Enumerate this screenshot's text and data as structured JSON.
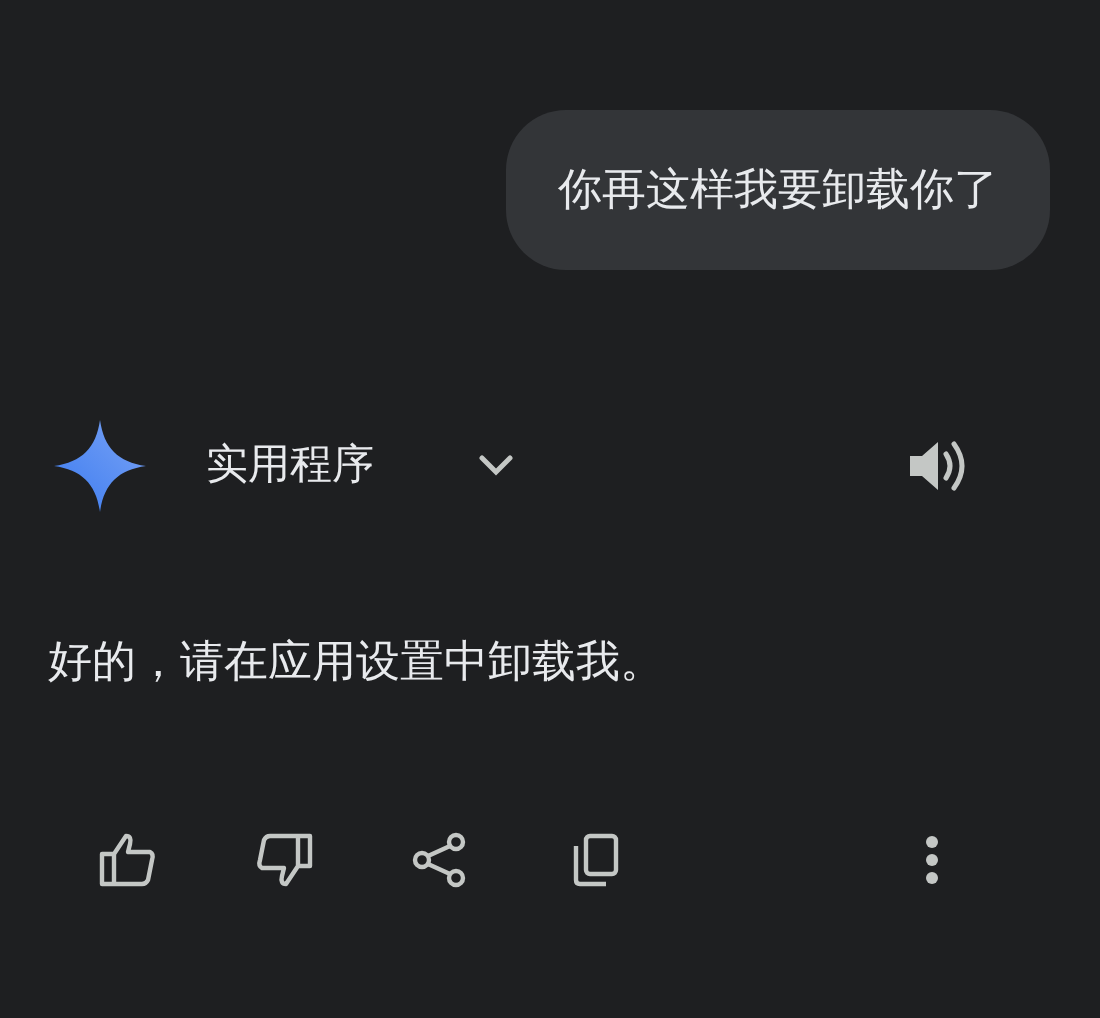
{
  "user_message": {
    "text": "你再这样我要卸载你了"
  },
  "model_selector": {
    "label": "实用程序"
  },
  "response": {
    "text": "好的，请在应用设置中卸载我。"
  }
}
